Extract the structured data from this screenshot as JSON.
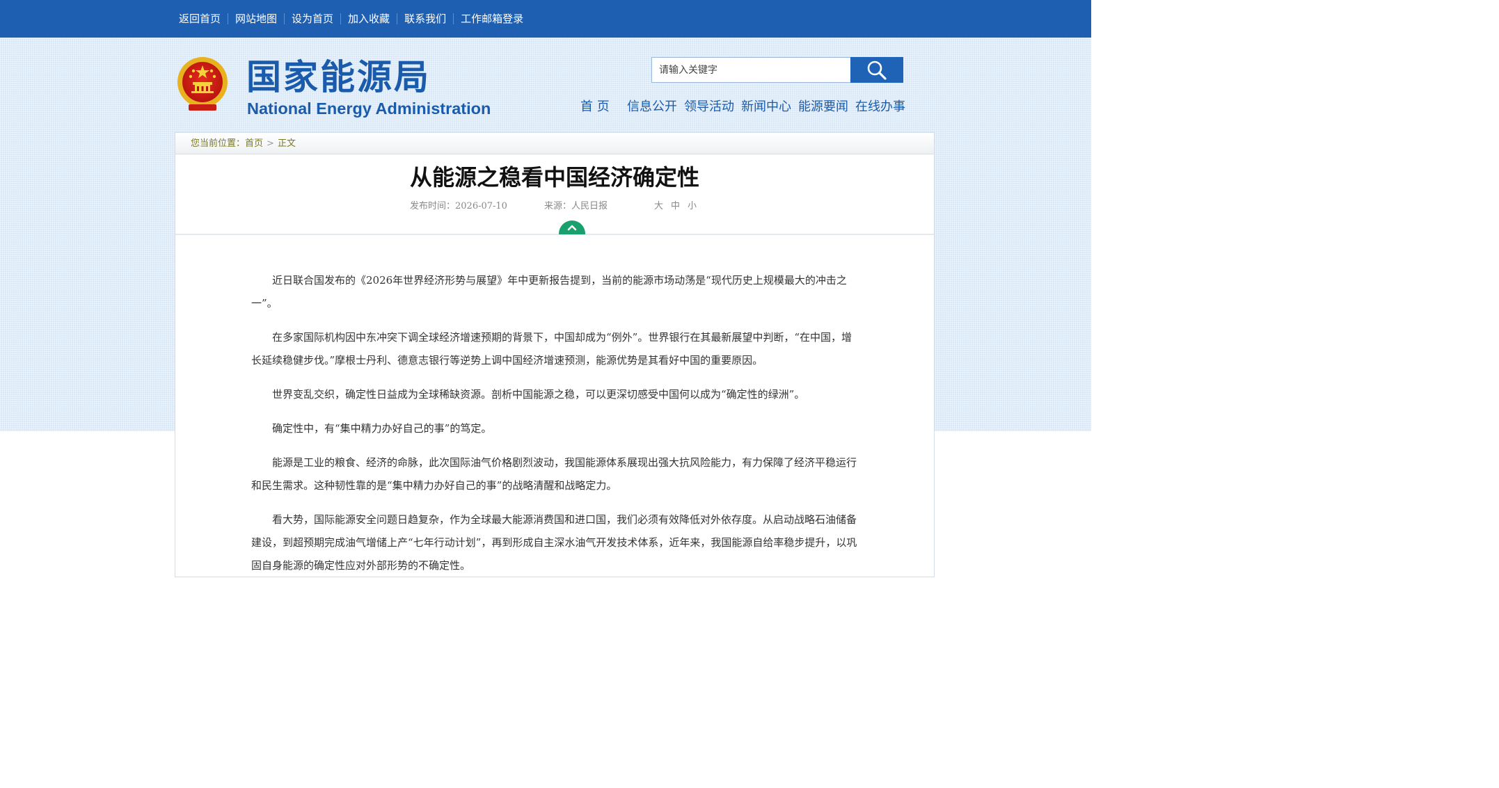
{
  "top_nav": [
    "返回首页",
    "网站地图",
    "设为首页",
    "加入收藏",
    "联系我们",
    "工作邮箱登录"
  ],
  "logo": {
    "cn": "国家能源局",
    "en": "National Energy Administration"
  },
  "search": {
    "placeholder": "请输入关键字"
  },
  "main_nav": [
    "首 页",
    "信息公开",
    "领导活动",
    "新闻中心",
    "能源要闻",
    "在线办事"
  ],
  "breadcrumb": {
    "prefix": "您当前位置：",
    "home": "首页",
    "current": "正文"
  },
  "article": {
    "title": "从能源之稳看中国经济确定性",
    "publish_time": "发布时间：2026-07-10",
    "source": "来源：人民日报",
    "font_sizes": [
      "大",
      "中",
      "小"
    ],
    "paragraphs": [
      "近日联合国发布的《2026年世界经济形势与展望》年中更新报告提到，当前的能源市场动荡是“现代历史上规模最大的冲击之一”。",
      "在多家国际机构因中东冲突下调全球经济增速预期的背景下，中国却成为“例外”。世界银行在其最新展望中判断，“在中国，增长延续稳健步伐。”摩根士丹利、德意志银行等逆势上调中国经济增速预测，能源优势是其看好中国的重要原因。",
      "世界变乱交织，确定性日益成为全球稀缺资源。剖析中国能源之稳，可以更深切感受中国何以成为“确定性的绿洲”。",
      "确定性中，有“集中精力办好自己的事”的笃定。",
      "能源是工业的粮食、经济的命脉，此次国际油气价格剧烈波动，我国能源体系展现出强大抗风险能力，有力保障了经济平稳运行和民生需求。这种韧性靠的是“集中精力办好自己的事”的战略清醒和战略定力。",
      "看大势，国际能源安全问题日趋复杂，作为全球最大能源消费国和进口国，我们必须有效降低对外依存度。从启动战略石油储备建设，到超预期完成油气增储上产“七年行动计划”，再到形成自主深水油气开发技术体系，近年来，我国能源自给率稳步提升，以巩固自身能源的确定性应对外部形势的不确定性。"
    ]
  },
  "colors": {
    "top_bar": "#1f5fb1",
    "brand_blue": "#1b5bab",
    "header_bg": "#d9e8f7",
    "up_button": "#1aa06d"
  }
}
